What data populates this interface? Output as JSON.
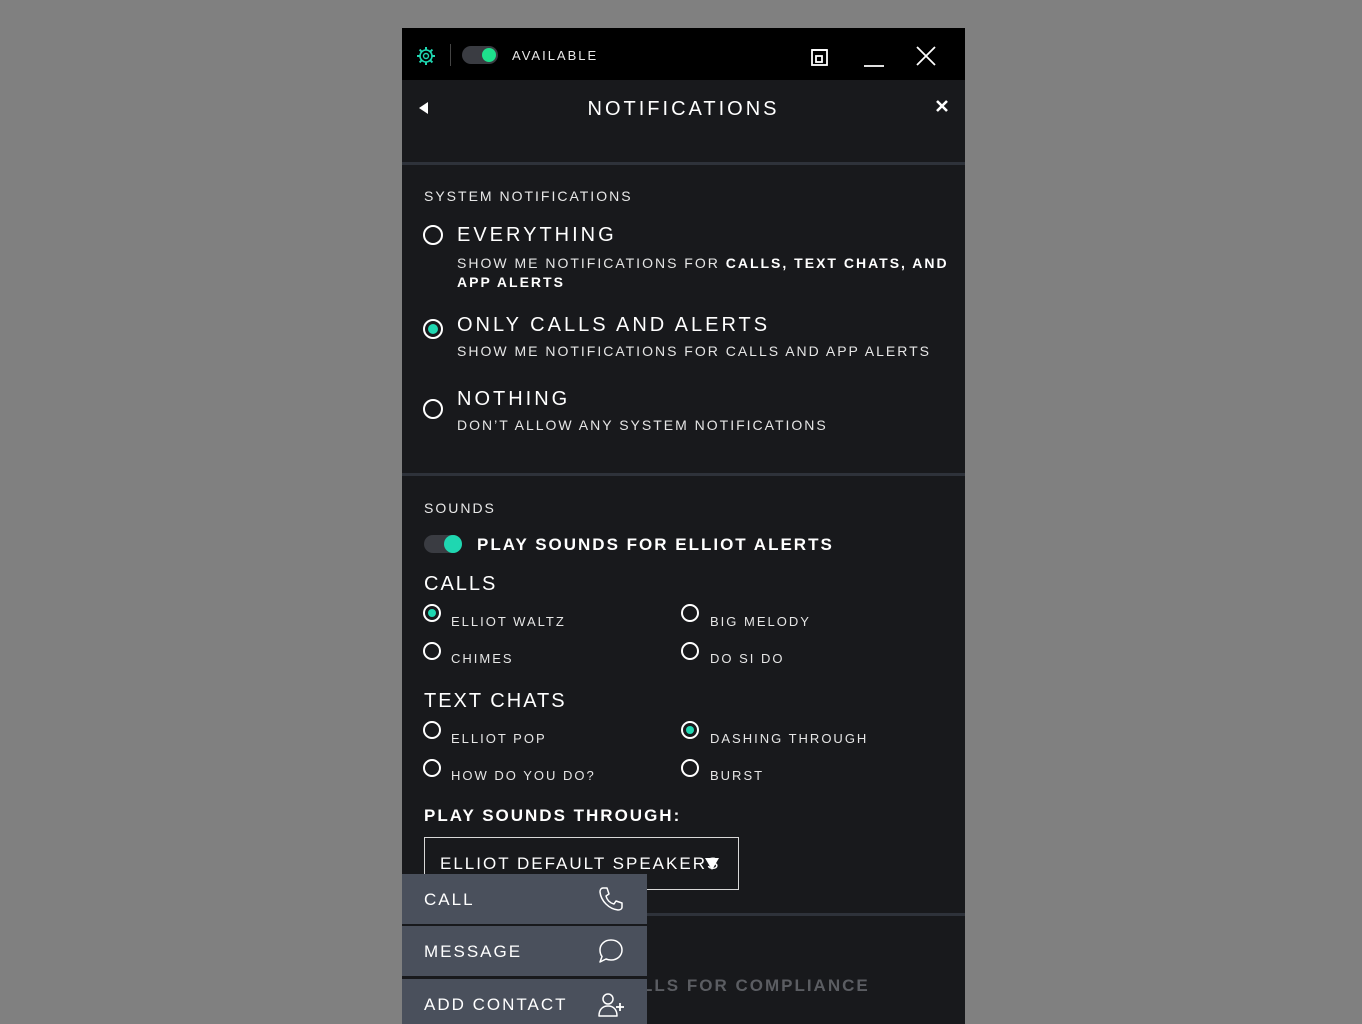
{
  "titlebar": {
    "status_text": "AVAILABLE",
    "status_on": true,
    "icons": [
      "gear-icon",
      "restore-icon",
      "minimize-icon",
      "close-icon"
    ]
  },
  "header": {
    "title": "NOTIFICATIONS",
    "icons": [
      "back-arrow-icon",
      "close-icon"
    ]
  },
  "system": {
    "label": "SYSTEM NOTIFICATIONS",
    "options": [
      {
        "title": "EVERYTHING",
        "desc_prefix": "SHOW ME NOTIFICATIONS FOR ",
        "desc_bold": "CALLS, TEXT CHATS, AND APP ALERTS",
        "selected": false
      },
      {
        "title": "ONLY CALLS AND ALERTS",
        "desc": "SHOW ME NOTIFICATIONS FOR CALLS AND APP ALERTS",
        "selected": true
      },
      {
        "title": "NOTHING",
        "desc": "DON’T ALLOW ANY SYSTEM NOTIFICATIONS",
        "selected": false
      }
    ]
  },
  "sounds": {
    "label": "SOUNDS",
    "toggle_label": "PLAY SOUNDS FOR ELLIOT ALERTS",
    "toggle_on": true,
    "calls": {
      "title": "CALLS",
      "options": [
        {
          "label": "ELLIOT WALTZ",
          "selected": true
        },
        {
          "label": "BIG MELODY",
          "selected": false
        },
        {
          "label": "CHIMES",
          "selected": false
        },
        {
          "label": "DO SI DO",
          "selected": false
        }
      ]
    },
    "text_chats": {
      "title": "TEXT CHATS",
      "options": [
        {
          "label": "ELLIOT POP",
          "selected": false
        },
        {
          "label": "DASHING THROUGH",
          "selected": true
        },
        {
          "label": "HOW DO YOU DO?",
          "selected": false
        },
        {
          "label": "BURST",
          "selected": false
        }
      ]
    },
    "through_label": "PLAY SOUNDS THROUGH:",
    "through_value": "ELLIOT DEFAULT SPEAKERS"
  },
  "compliance": {
    "partial_text": "LLS FOR COMPLIANCE"
  },
  "context_menu": {
    "items": [
      {
        "label": "CALL",
        "icon": "phone-icon"
      },
      {
        "label": "MESSAGE",
        "icon": "chat-bubble-icon"
      },
      {
        "label": "ADD CONTACT",
        "icon": "add-contact-icon"
      }
    ]
  },
  "colors": {
    "accent_teal": "#1fd7b1",
    "status_green": "#1ee08c",
    "panel_bg": "#18191c",
    "menu_bg": "#4a505c",
    "page_bg": "#808080"
  }
}
